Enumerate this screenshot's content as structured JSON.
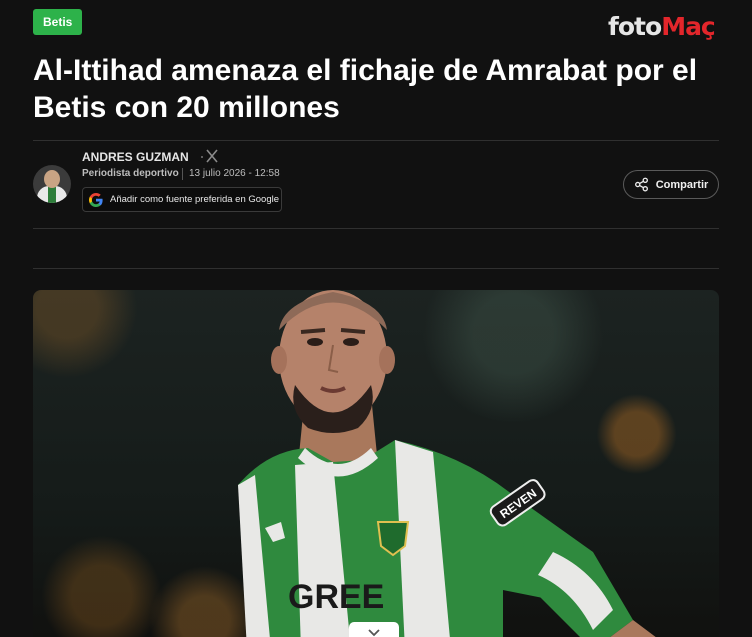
{
  "category": {
    "label": "Betis"
  },
  "brand": {
    "part1": "foto",
    "part2": "Maç"
  },
  "article": {
    "title": "Al-Ittihad amenaza el fichaje de Amrabat por el Betis con 20 millones"
  },
  "author": {
    "name": "ANDRES GUZMAN",
    "role": "Periodista deportivo",
    "date": "13 julio 2026 - 12:58"
  },
  "google_button": {
    "label": "Añadir como fuente preferida en Google"
  },
  "share_button": {
    "label": "Compartir"
  },
  "photo": {
    "jersey_sponsor": "GREE",
    "sleeve_patch": "REVEN"
  },
  "colors": {
    "accent_green": "#2db24a",
    "brand_red": "#e3262b",
    "background": "#111111"
  },
  "icons": [
    "x-icon",
    "google-icon",
    "share-icon",
    "chevron-down-icon"
  ]
}
